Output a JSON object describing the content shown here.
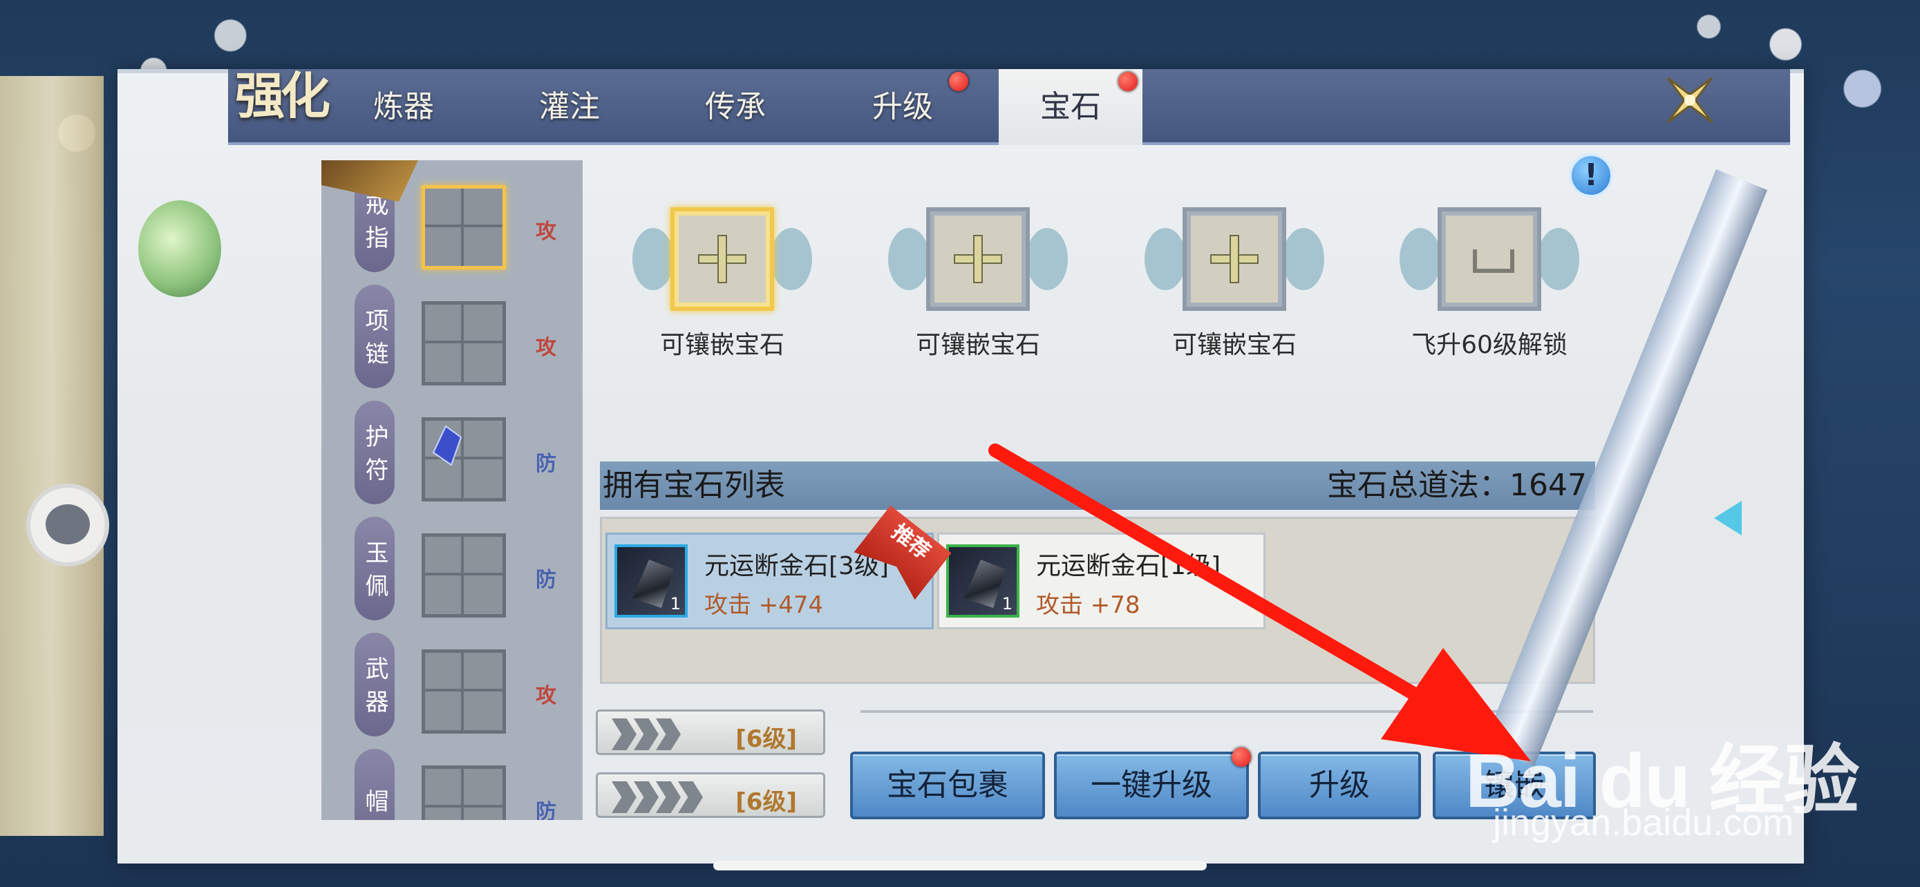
{
  "tabs": {
    "title": "强化",
    "items": [
      "炼器",
      "灌注",
      "传承",
      "升级",
      "宝石"
    ],
    "active_index": 4,
    "red_dot_tabs": [
      "升级",
      "宝石"
    ]
  },
  "equipment": [
    {
      "name": "戒指",
      "tag": "攻",
      "tag_type": "attack",
      "selected": true
    },
    {
      "name": "项链",
      "tag": "攻",
      "tag_type": "attack",
      "selected": false
    },
    {
      "name": "护符",
      "tag": "防",
      "tag_type": "defense",
      "selected": false
    },
    {
      "name": "玉佩",
      "tag": "防",
      "tag_type": "defense",
      "selected": false
    },
    {
      "name": "武器",
      "tag": "攻",
      "tag_type": "attack",
      "selected": false
    },
    {
      "name": "帽",
      "tag": "防",
      "tag_type": "defense",
      "selected": false
    }
  ],
  "gem_slots": [
    {
      "label": "可镶嵌宝石",
      "state": "open",
      "selected": true
    },
    {
      "label": "可镶嵌宝石",
      "state": "open",
      "selected": false
    },
    {
      "label": "可镶嵌宝石",
      "state": "open",
      "selected": false
    },
    {
      "label": "飞升60级解锁",
      "state": "locked",
      "selected": false
    }
  ],
  "owned_list": {
    "title": "拥有宝石列表",
    "total_label": "宝石总道法：1647",
    "items": [
      {
        "name": "元运断金石[3级]",
        "stat": "攻击 +474",
        "count": "1",
        "badge": "推荐",
        "border": "blue"
      },
      {
        "name": "元运断金石[1级]",
        "stat": "攻击 +78",
        "count": "1",
        "badge": "",
        "border": "green"
      }
    ]
  },
  "level_filters": [
    {
      "label": "[6级]",
      "arrows": 3
    },
    {
      "label": "[6级]",
      "arrows": 4
    }
  ],
  "buttons": {
    "gem_bag": "宝石包裹",
    "one_key_upgrade": "一键升级",
    "upgrade": "升级",
    "inlay": "镶嵌"
  },
  "watermark": {
    "big": "Bai du 经验",
    "small": "jingyan.baidu.com"
  },
  "colors": {
    "accent": "#4f88c6",
    "attack_tag": "#c0463f",
    "defense_tag": "#4a62b0",
    "red_dot": "#e21b1b",
    "arrow": "#ff1a0e"
  }
}
